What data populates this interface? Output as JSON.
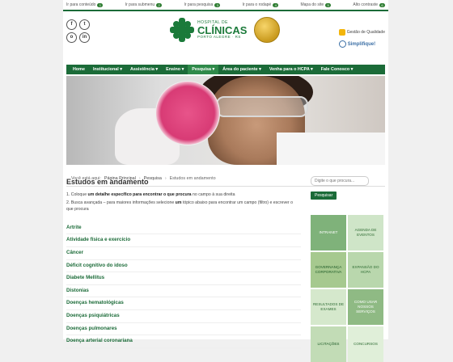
{
  "access_bar": [
    {
      "label": "Ir para conteúdo",
      "key": "1"
    },
    {
      "label": "Ir para submenu",
      "key": "2"
    },
    {
      "label": "Ir para pesquisa",
      "key": "3"
    },
    {
      "label": "Ir para o rodapé",
      "key": "4"
    },
    {
      "label": "Mapa do site",
      "key": "5"
    },
    {
      "label": "Alto contraste",
      "key": "6"
    }
  ],
  "social": [
    "f",
    "t",
    "o",
    "in"
  ],
  "logo": {
    "line1": "HOSPITAL DE",
    "line2": "CLÍNICAS",
    "line3": "PORTO ALEGRE · RS"
  },
  "right_logos": {
    "ok_label": "Gestão de Qualidade",
    "simplifique": "Simplifique!"
  },
  "nav": [
    "Home",
    "Institucional ▾",
    "Assistência ▾",
    "Ensino ▾",
    "Pesquisa ▾",
    "Área do paciente ▾",
    "Venha para o HCPA ▾",
    "Fale Conosco ▾"
  ],
  "breadcrumb": {
    "prefix": "Você está aqui:",
    "items": [
      "Página Principal",
      "Pesquisa",
      "Estudos em andamento"
    ]
  },
  "main": {
    "title": "Estudos em andamento",
    "p1_a": "1. Coloque ",
    "p1_b": "um detalhe específico para encontrar o que procura",
    "p1_c": " no campo à sua direita",
    "p2_a": "2. Busca avançada – para maiores informações selecione ",
    "p2_b": "um",
    "p2_c": " tópico abaixo para encontrar um campo (filtro) e escrever o que procura",
    "topics": [
      "Artrite",
      "Atividade física e exercício",
      "Câncer",
      "Déficit cognitivo do idoso",
      "Diabete Mellitus",
      "Distonias",
      "Doenças hematológicas",
      "Doenças psiquiátricas",
      "Doenças pulmonares",
      "Doença arterial coronariana"
    ]
  },
  "side": {
    "search_placeholder": "Digite o que procura...",
    "search_button": "Pesquisar",
    "tiles": [
      "INTRANET",
      "AGENDA DE EVENTOS",
      "GOVERNANÇA CORPORATIVA",
      "EXPANSÃO DO HCPA",
      "RESULTADOS DE EXAMES",
      "COMO USAR NOSSOS SERVIÇOS",
      "LICITAÇÕES",
      "CONCURSOS"
    ]
  },
  "colors": {
    "brand_green": "#1b6b38",
    "accent": "#2f8a4a"
  }
}
